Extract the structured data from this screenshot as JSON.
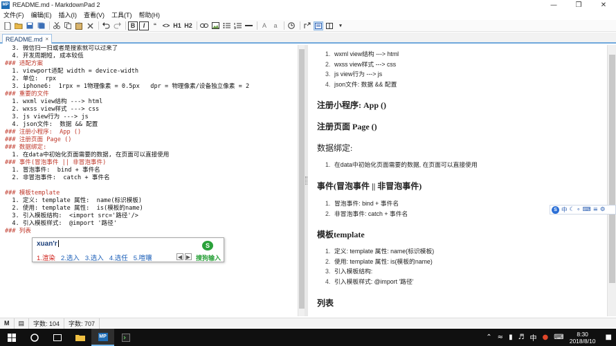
{
  "window": {
    "app_icon": "MP",
    "title": "README.md - MarkdownPad 2",
    "minimize": "—",
    "maximize": "❒",
    "close": "✕"
  },
  "menu": [
    "文件(F)",
    "编辑(E)",
    "插入(I)",
    "查看(V)",
    "工具(T)",
    "帮助(H)"
  ],
  "toolbar": {
    "bold": "B",
    "italic": "I",
    "quote": "“",
    "code": "<>",
    "h1": "H1",
    "h2": "H2",
    "strike": "abc",
    "capital": "A",
    "lower": "a",
    "icons": [
      "new-file-icon",
      "open-folder-icon",
      "save-icon",
      "save-all-icon",
      "cut-icon",
      "copy-icon",
      "paste-icon",
      "delete-icon",
      "undo-icon",
      "redo-icon",
      "link-icon",
      "image-icon",
      "bullet-list-icon",
      "numbered-list-icon",
      "horizontal-rule-icon",
      "timestamp-icon",
      "export-icon",
      "live-preview-icon",
      "split-view-icon"
    ]
  },
  "tab": {
    "label": "README.md",
    "close": "×"
  },
  "editor_lines": [
    {
      "t": "  3. 微信扫一扫或者是搜索就可以过来了",
      "k": "num"
    },
    {
      "t": "  4. 开发周期短, 成本较低",
      "k": "num"
    },
    {
      "t": "### 适配方案",
      "k": "hdr"
    },
    {
      "t": "  1. viewport适配 width = device-width",
      "k": "num"
    },
    {
      "t": "  2. 单位:  rpx",
      "k": "num"
    },
    {
      "t": "  3. iphone6:  1rpx = 1物理像素 = 0.5px   dpr = 物理像素/设备独立像素 = 2",
      "k": "num"
    },
    {
      "t": "### 重要的文件",
      "k": "hdr"
    },
    {
      "t": "  1. wxml view结构 ---> html",
      "k": "num"
    },
    {
      "t": "  2. wxss view样式 ---> css",
      "k": "num"
    },
    {
      "t": "  3. js view行为 ---> js",
      "k": "num"
    },
    {
      "t": "  4. json文件:  数据 && 配置",
      "k": "num"
    },
    {
      "t": "### 注册小程序:  App ()",
      "k": "hdr"
    },
    {
      "t": "### 注册页面 Page ()",
      "k": "hdr"
    },
    {
      "t": "### 数据绑定:",
      "k": "hdr"
    },
    {
      "t": "  1. 在data中初始化页面需要的数据, 在页面可以直接使用",
      "k": "num"
    },
    {
      "t": "### 事件(冒泡事件 || 非冒泡事件)",
      "k": "hdr"
    },
    {
      "t": "  1. 冒泡事件:  bind + 事件名",
      "k": "num"
    },
    {
      "t": "  2. 非冒泡事件:  catch + 事件名",
      "k": "num"
    },
    {
      "t": "",
      "k": "num"
    },
    {
      "t": "### 模板template",
      "k": "hdr"
    },
    {
      "t": "  1. 定义: template 属性:  name(标识模板)",
      "k": "num"
    },
    {
      "t": "  2. 使用: template 属性:  is(模板的name)",
      "k": "num"
    },
    {
      "t": "  3. 引入模板结构:  <import src='路径'/>",
      "k": "num"
    },
    {
      "t": "  4. 引入模板样式:  @import '路径'",
      "k": "num"
    },
    {
      "t": "### 列表",
      "k": "hdr"
    }
  ],
  "preview": {
    "files": [
      "wxml view结构 ---> html",
      "wxss view样式 ---> css",
      "js view行为 ---> js",
      "json文件: 数据 && 配置"
    ],
    "h_app": "注册小程序: App ()",
    "h_page": "注册页面 Page ()",
    "h_binding": "数据绑定:",
    "binding": [
      "在data中初始化页面需要的数据, 在页面可以直接使用"
    ],
    "h_events": "事件(冒泡事件 || 非冒泡事件)",
    "events": [
      "冒泡事件: bind + 事件名",
      "非冒泡事件: catch + 事件名"
    ],
    "h_template": "模板template",
    "template": [
      "定义: template 属性: name(标识模板)",
      "使用: template 属性: is(模板的name)",
      "引入模板结构:",
      "引入模板样式: @import '路径'"
    ],
    "h_list": "列表"
  },
  "ime": {
    "composition": "xuan'r",
    "candidates": [
      "1.渲染",
      "2.选入",
      "3.选入",
      "4.选任",
      "5.喧嚷"
    ],
    "brand": "搜狗输入",
    "logo": "S",
    "bar_items": [
      "中",
      "☾",
      "∘",
      "⌨",
      "≡",
      "⚙"
    ]
  },
  "status": {
    "words": "字数: 104",
    "chars": "字数: 707"
  },
  "taskbar": {
    "tray_lang": "中",
    "time": "8:30",
    "date": "2018/8/10"
  },
  "colors": {
    "accent": "#6fa8dc",
    "heading": "#c0392b",
    "ime_red": "#d0201a",
    "ime_green": "#2aa13a"
  }
}
